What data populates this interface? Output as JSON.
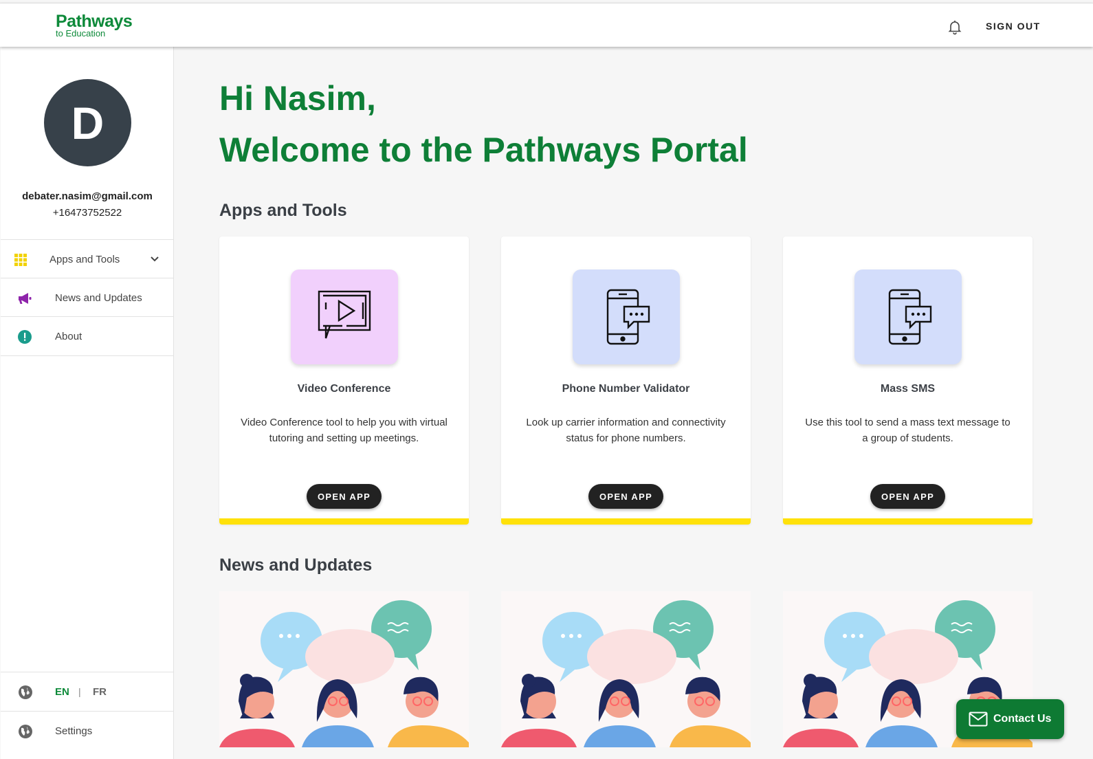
{
  "header": {
    "logo_line1": "Pathways",
    "logo_line2": "to Education",
    "sign_out": "SIGN OUT"
  },
  "profile": {
    "initial": "D",
    "email": "debater.nasim@gmail.com",
    "phone": "+16473752522"
  },
  "sidebar": {
    "items": [
      {
        "label": "Apps and Tools",
        "icon": "grid-icon",
        "color": "#f2d200"
      },
      {
        "label": "News and Updates",
        "icon": "megaphone-icon",
        "color": "#8e24aa"
      },
      {
        "label": "About",
        "icon": "info-icon",
        "color": "#1a9c8c"
      }
    ],
    "lang_en": "EN",
    "lang_sep": "|",
    "lang_fr": "FR",
    "settings": "Settings"
  },
  "main": {
    "greeting": "Hi Nasim,",
    "welcome": "Welcome to the Pathways Portal",
    "apps_title": "Apps and Tools",
    "news_title": "News and Updates",
    "apps": [
      {
        "title": "Video Conference",
        "description": "Video Conference tool to help you with virtual tutoring and setting up meetings.",
        "button": "OPEN APP",
        "icon": "video-chat-icon",
        "tile_color": "#f1d0fc"
      },
      {
        "title": "Phone Number Validator",
        "description": "Look up carrier information and connectivity status for phone numbers.",
        "button": "OPEN APP",
        "icon": "phone-message-icon",
        "tile_color": "#d3ddfb"
      },
      {
        "title": "Mass SMS",
        "description": "Use this tool to send a mass text message to a group of students.",
        "button": "OPEN APP",
        "icon": "phone-message-icon",
        "tile_color": "#d3ddfb"
      }
    ]
  },
  "contact": {
    "label": "Contact Us"
  },
  "colors": {
    "brand_green": "#0e7f37",
    "accent_yellow": "#ffe10a",
    "dark": "#222222"
  }
}
